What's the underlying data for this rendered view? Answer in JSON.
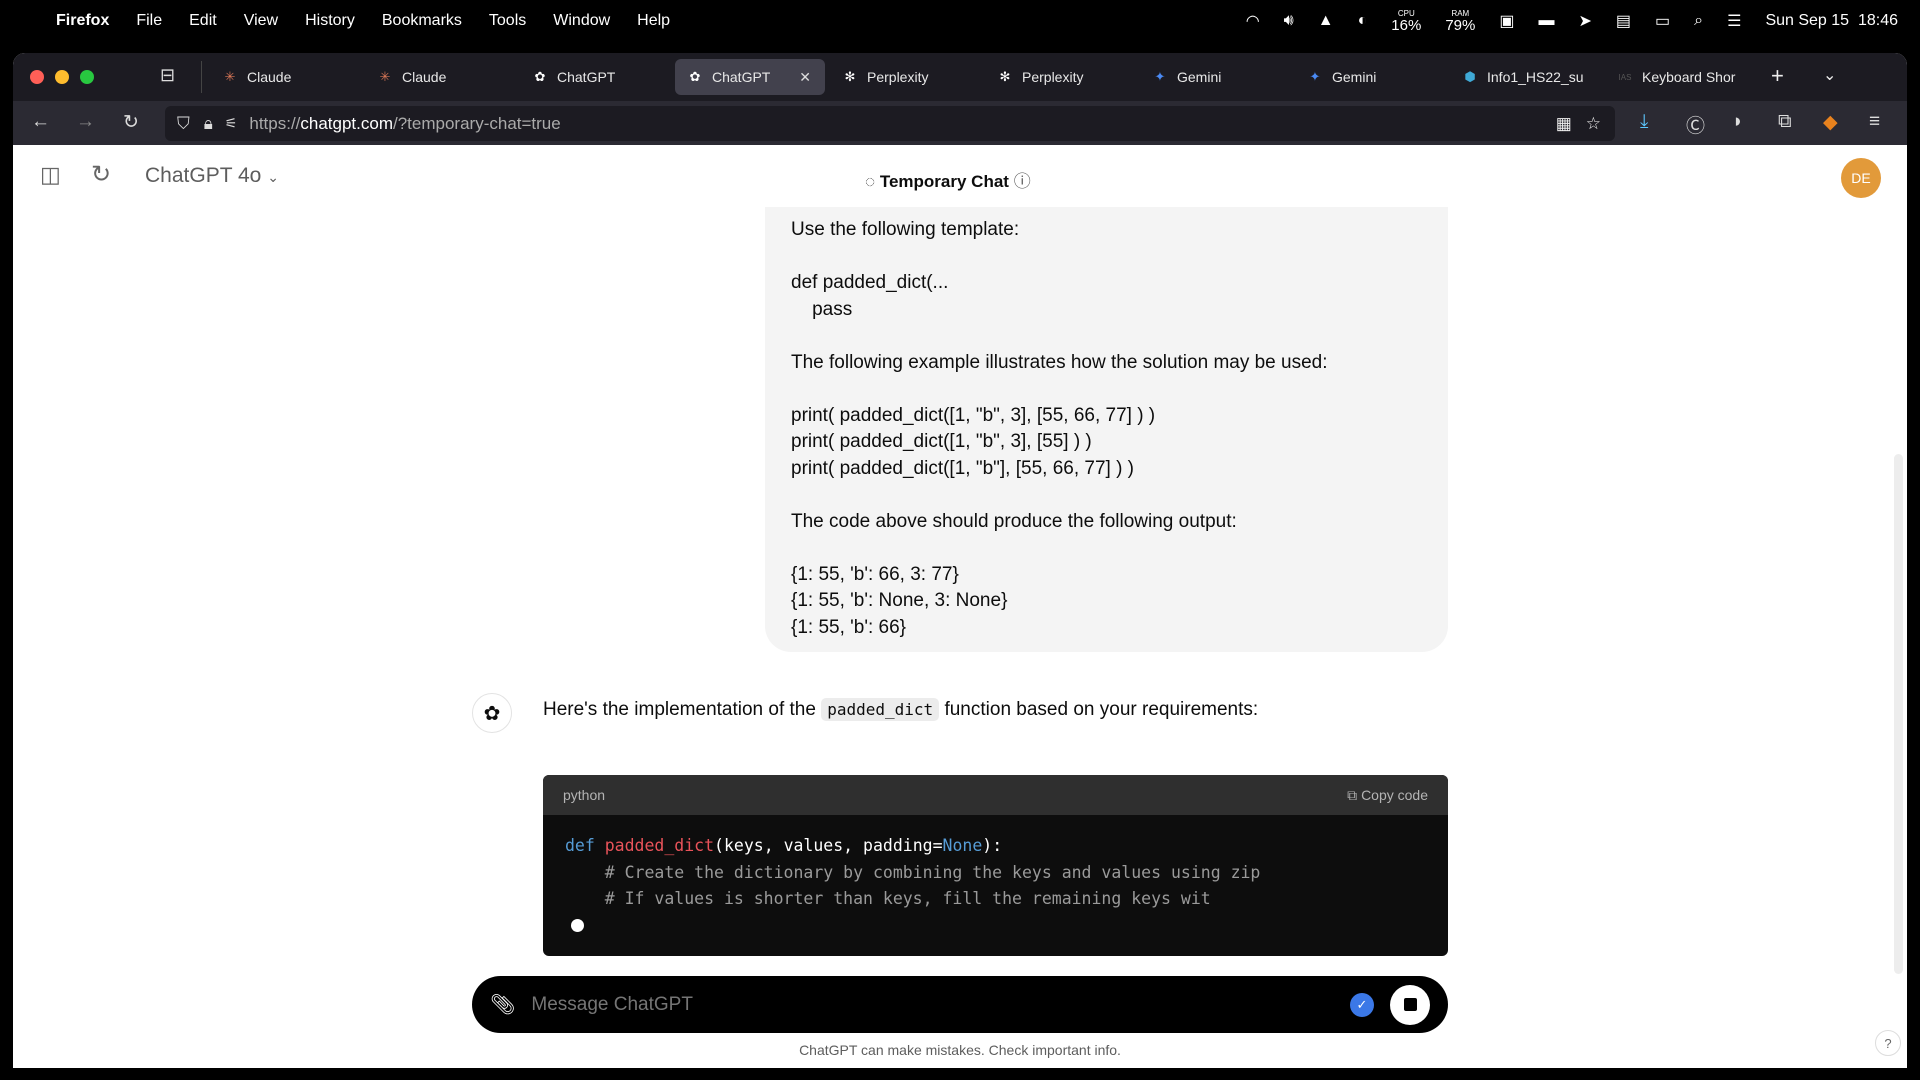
{
  "menubar": {
    "app": "Firefox",
    "items": [
      "File",
      "Edit",
      "View",
      "History",
      "Bookmarks",
      "Tools",
      "Window",
      "Help"
    ],
    "cpu_label": "CPU",
    "cpu": "16%",
    "ram_label": "RAM",
    "ram": "79%",
    "datetime": "Sun Sep 15  18:46"
  },
  "tabs": [
    {
      "label": "Claude",
      "icon": "claude-icon",
      "color": "#d97757"
    },
    {
      "label": "Claude",
      "icon": "claude-icon",
      "color": "#d97757"
    },
    {
      "label": "ChatGPT",
      "icon": "chatgpt-icon",
      "color": "#ffffff"
    },
    {
      "label": "ChatGPT",
      "icon": "chatgpt-icon",
      "color": "#ffffff",
      "active": true
    },
    {
      "label": "Perplexity",
      "icon": "perplexity-icon",
      "color": "#ffffff"
    },
    {
      "label": "Perplexity",
      "icon": "perplexity-icon",
      "color": "#ffffff"
    },
    {
      "label": "Gemini",
      "icon": "gemini-icon",
      "color": "#4a8af4"
    },
    {
      "label": "Gemini",
      "icon": "gemini-icon",
      "color": "#4a8af4"
    },
    {
      "label": "Info1_HS22_su",
      "icon": "moodle-icon",
      "color": "#3fa9d6"
    },
    {
      "label": "Keyboard Shor",
      "icon": "ias-icon",
      "color": "#555555"
    }
  ],
  "url": {
    "prefix": "https://",
    "domain": "chatgpt.com",
    "path": "/?temporary-chat=true"
  },
  "header": {
    "model": "ChatGPT 4o",
    "center": "Temporary Chat",
    "avatar": "DE",
    "avatar_color": "#e29a3a"
  },
  "user_message": [
    "Use the following template:",
    "",
    "def padded_dict(...",
    "    pass",
    "",
    "The following example illustrates how the solution may be used:",
    "",
    "print( padded_dict([1, \"b\", 3], [55, 66, 77] ) )",
    "print( padded_dict([1, \"b\", 3], [55] ) )",
    "print( padded_dict([1, \"b\"], [55, 66, 77] ) )",
    "",
    "The code above should produce the following output:",
    "",
    "{1: 55, 'b': 66, 3: 77}",
    "{1: 55, 'b': None, 3: None}",
    "{1: 55, 'b': 66}"
  ],
  "assistant": {
    "intro_before": "Here's the implementation of the ",
    "intro_code": "padded_dict",
    "intro_after": " function based on your requirements:",
    "code_lang": "python",
    "copy_label": "Copy code",
    "code": {
      "kw": "def",
      "fn": "padded_dict",
      "args": "(keys, values, padding=",
      "none": "None",
      "end": "):",
      "comment1": "    # Create the dictionary by combining the keys and values using zip",
      "comment2": "    # If values is shorter than keys, fill the remaining keys wit"
    }
  },
  "composer": {
    "placeholder": "Message ChatGPT"
  },
  "footnote": "ChatGPT can make mistakes. Check important info.",
  "help": "?"
}
